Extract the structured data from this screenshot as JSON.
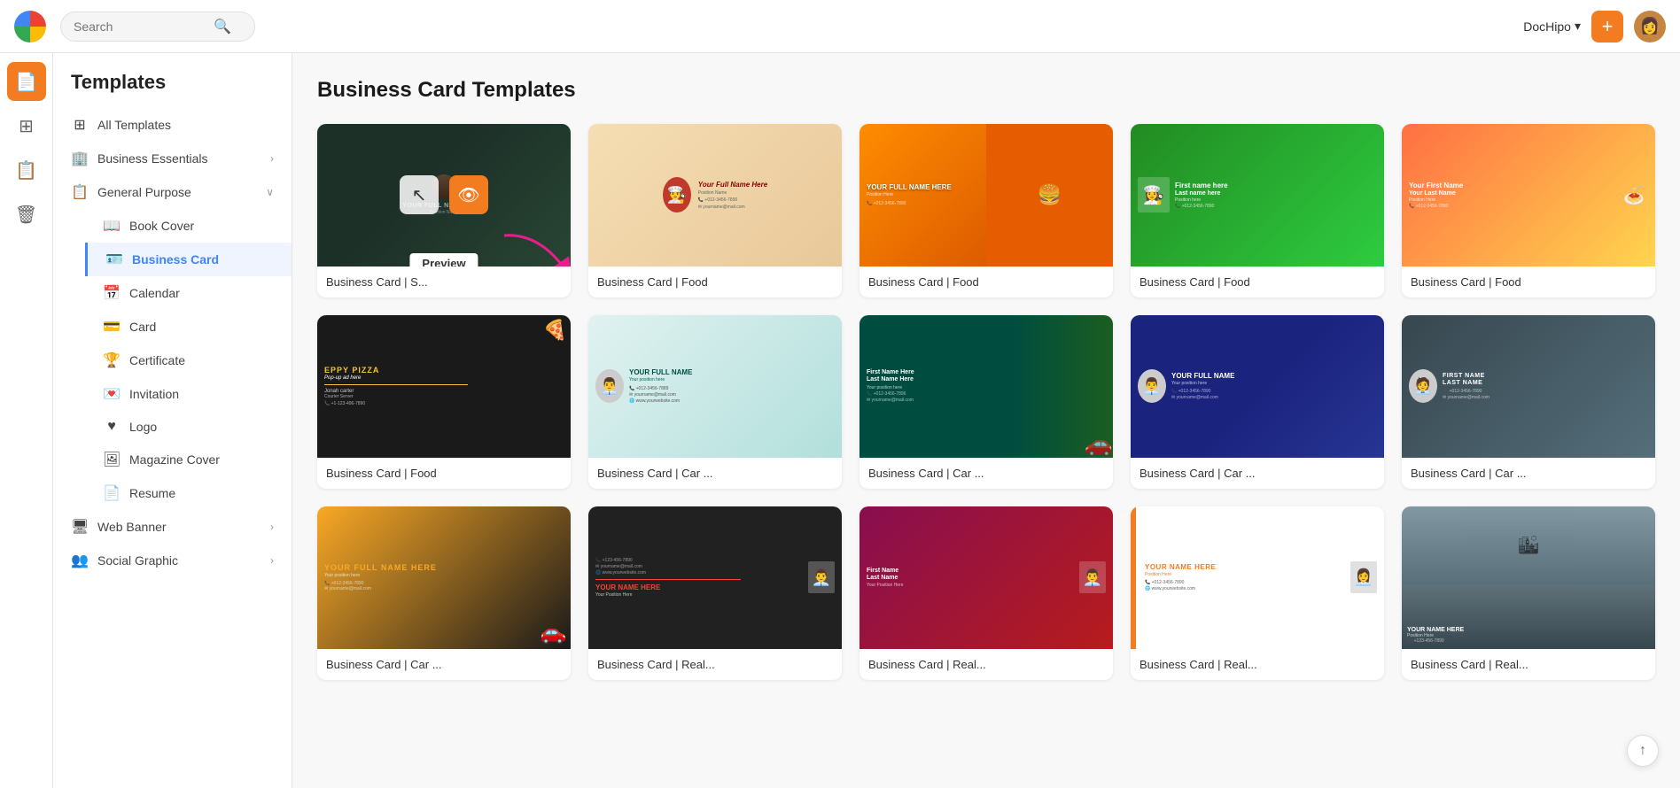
{
  "header": {
    "search_placeholder": "Search",
    "brand": "DocHipo",
    "add_btn_label": "+",
    "chevron": "▾"
  },
  "icon_sidebar": {
    "items": [
      {
        "name": "document-icon",
        "icon": "📄",
        "active": true
      },
      {
        "name": "grid-icon",
        "icon": "⊞",
        "active": false
      },
      {
        "name": "layers-icon",
        "icon": "📋",
        "active": false
      },
      {
        "name": "trash-icon",
        "icon": "🗑",
        "active": false
      }
    ]
  },
  "nav_sidebar": {
    "title": "Templates",
    "items": [
      {
        "label": "All Templates",
        "icon": "⊞",
        "level": 0
      },
      {
        "label": "Business Essentials",
        "icon": "🏢",
        "level": 0,
        "has_chevron": true
      },
      {
        "label": "General Purpose",
        "icon": "📋",
        "level": 0,
        "expanded": true
      },
      {
        "label": "Book Cover",
        "icon": "📖",
        "level": 1
      },
      {
        "label": "Business Card",
        "icon": "🪪",
        "level": 1,
        "active": true
      },
      {
        "label": "Calendar",
        "icon": "📅",
        "level": 1
      },
      {
        "label": "Card",
        "icon": "💳",
        "level": 1
      },
      {
        "label": "Certificate",
        "icon": "🏆",
        "level": 1
      },
      {
        "label": "Invitation",
        "icon": "💌",
        "level": 1
      },
      {
        "label": "Logo",
        "icon": "❤",
        "level": 1
      },
      {
        "label": "Magazine Cover",
        "icon": "🖼",
        "level": 1
      },
      {
        "label": "Resume",
        "icon": "📄",
        "level": 1
      },
      {
        "label": "Web Banner",
        "icon": "🖥",
        "level": 0,
        "has_chevron": true
      },
      {
        "label": "Social Graphic",
        "icon": "👥",
        "level": 0,
        "has_chevron": true
      }
    ]
  },
  "main": {
    "page_title": "Business Card Templates",
    "templates": [
      {
        "label": "Business Card | S...",
        "row": 1,
        "thumb_type": "bc-social",
        "hovered": true,
        "overlay_preview": "Preview"
      },
      {
        "label": "Business Card | Food",
        "row": 1,
        "thumb_type": "food1"
      },
      {
        "label": "Business Card | Food",
        "row": 1,
        "thumb_type": "food2"
      },
      {
        "label": "Business Card | Food",
        "row": 1,
        "thumb_type": "food3"
      },
      {
        "label": "Business Card | Food",
        "row": 1,
        "thumb_type": "food4"
      },
      {
        "label": "Business Card | Food",
        "row": 2,
        "thumb_type": "pizza"
      },
      {
        "label": "Business Card | Car ...",
        "row": 2,
        "thumb_type": "car1"
      },
      {
        "label": "Business Card | Car ...",
        "row": 2,
        "thumb_type": "car2"
      },
      {
        "label": "Business Card | Car ...",
        "row": 2,
        "thumb_type": "car3"
      },
      {
        "label": "Business Card | Car ...",
        "row": 2,
        "thumb_type": "car4"
      },
      {
        "label": "Business Card | Car ...",
        "row": 3,
        "thumb_type": "carb1"
      },
      {
        "label": "Business Card | Real...",
        "row": 3,
        "thumb_type": "real1"
      },
      {
        "label": "Business Card | Real...",
        "row": 3,
        "thumb_type": "real2"
      },
      {
        "label": "Business Card | Real...",
        "row": 3,
        "thumb_type": "real3"
      },
      {
        "label": "Business Card | Real...",
        "row": 3,
        "thumb_type": "real4"
      }
    ]
  },
  "scroll_top": "↑"
}
